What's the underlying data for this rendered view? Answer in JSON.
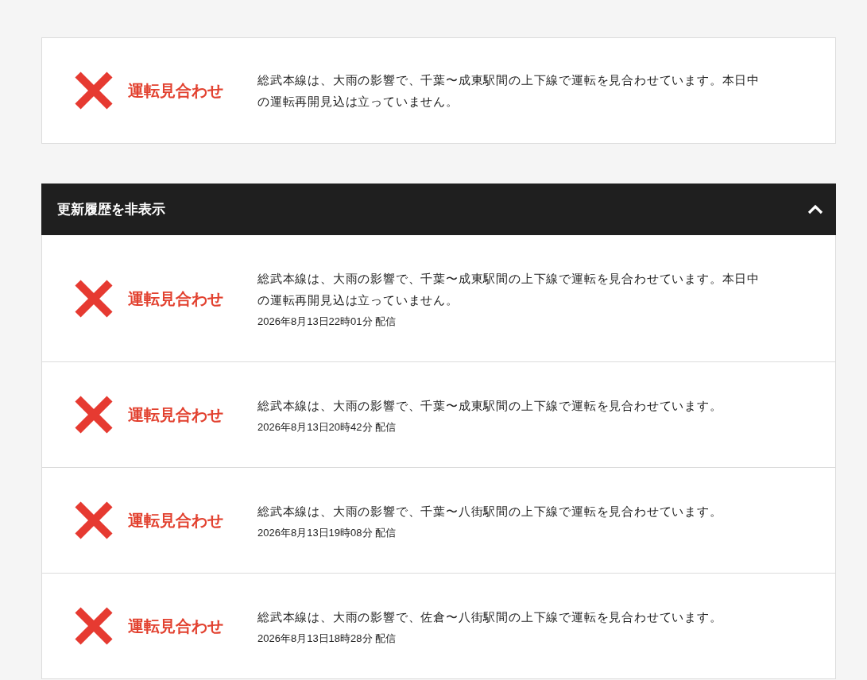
{
  "current": {
    "status": {
      "kind": "suspended",
      "label": "運転見合わせ"
    },
    "message": "総武本線は、大雨の影響で、千葉〜成東駅間の上下線で運転を見合わせています。本日中の運転再開見込は立っていません。"
  },
  "history": {
    "toggle_label": "更新履歴を非表示",
    "expanded": true,
    "items": [
      {
        "status": {
          "kind": "suspended",
          "label": "運転見合わせ"
        },
        "message": "総武本線は、大雨の影響で、千葉〜成東駅間の上下線で運転を見合わせています。本日中の運転再開見込は立っていません。",
        "timestamp": "2026年8月13日22時01分 配信"
      },
      {
        "status": {
          "kind": "suspended",
          "label": "運転見合わせ"
        },
        "message": "総武本線は、大雨の影響で、千葉〜成東駅間の上下線で運転を見合わせています。",
        "timestamp": "2026年8月13日20時42分 配信"
      },
      {
        "status": {
          "kind": "suspended",
          "label": "運転見合わせ"
        },
        "message": "総武本線は、大雨の影響で、千葉〜八街駅間の上下線で運転を見合わせています。",
        "timestamp": "2026年8月13日19時08分 配信"
      },
      {
        "status": {
          "kind": "suspended",
          "label": "運転見合わせ"
        },
        "message": "総武本線は、大雨の影響で、佐倉〜八街駅間の上下線で運転を見合わせています。",
        "timestamp": "2026年8月13日18時28分 配信"
      }
    ]
  }
}
